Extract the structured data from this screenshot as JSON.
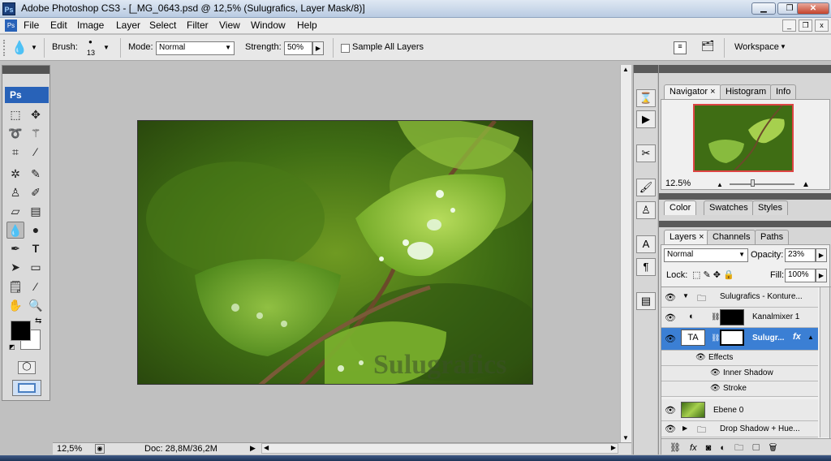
{
  "window": {
    "title": "Adobe Photoshop CS3 - [_MG_0643.psd @ 12,5% (Sulugrafics, Layer Mask/8)]",
    "app_icon": "Ps"
  },
  "menu": [
    "File",
    "Edit",
    "Image",
    "Layer",
    "Select",
    "Filter",
    "View",
    "Window",
    "Help"
  ],
  "options": {
    "brush_label": "Brush:",
    "brush_size": "13",
    "mode_label": "Mode:",
    "mode_value": "Normal",
    "strength_label": "Strength:",
    "strength_value": "50%",
    "sample_all_label": "Sample All Layers",
    "workspace_label": "Workspace"
  },
  "toolbox": {
    "badge": "Ps"
  },
  "document": {
    "watermark": "Sulugrafics"
  },
  "status": {
    "zoom": "12,5%",
    "doc": "Doc: 28,8M/36,2M"
  },
  "navigator": {
    "tabs": [
      "Navigator",
      "Histogram",
      "Info"
    ],
    "zoom": "12.5%"
  },
  "color_panel": {
    "tabs": [
      "Color",
      "Swatches",
      "Styles"
    ]
  },
  "layers_panel": {
    "tabs": [
      "Layers",
      "Channels",
      "Paths"
    ],
    "blend_mode": "Normal",
    "opacity_label": "Opacity:",
    "opacity": "23%",
    "lock_label": "Lock:",
    "fill_label": "Fill:",
    "fill": "100%",
    "layers": {
      "group1": "Sulugrafics - Konture...",
      "kanalmixer": "Kanalmixer 1",
      "sulugrafics": "Sulugr...",
      "effects": "Effects",
      "inner_shadow": "Inner Shadow",
      "stroke": "Stroke",
      "ebene0": "Ebene 0",
      "group2": "Drop Shadow + Hue..."
    }
  },
  "colors": {
    "selection": "#3b7fd4",
    "accent": "#2862b8"
  }
}
